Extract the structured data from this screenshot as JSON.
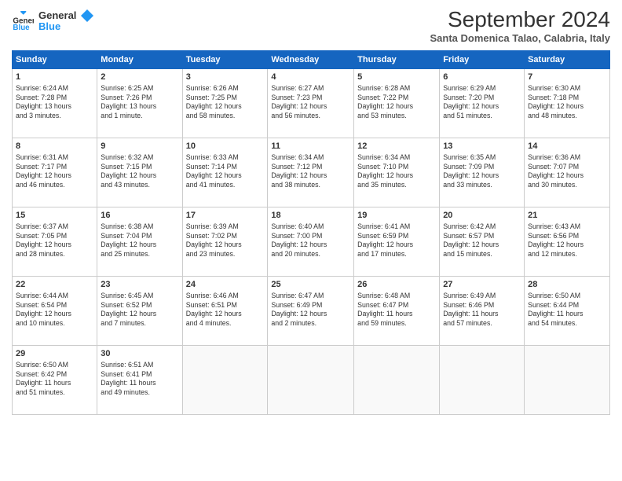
{
  "logo": {
    "line1": "General",
    "line2": "Blue"
  },
  "title": "September 2024",
  "subtitle": "Santa Domenica Talao, Calabria, Italy",
  "headers": [
    "Sunday",
    "Monday",
    "Tuesday",
    "Wednesday",
    "Thursday",
    "Friday",
    "Saturday"
  ],
  "weeks": [
    [
      {
        "day": "1",
        "info": "Sunrise: 6:24 AM\nSunset: 7:28 PM\nDaylight: 13 hours\nand 3 minutes."
      },
      {
        "day": "2",
        "info": "Sunrise: 6:25 AM\nSunset: 7:26 PM\nDaylight: 13 hours\nand 1 minute."
      },
      {
        "day": "3",
        "info": "Sunrise: 6:26 AM\nSunset: 7:25 PM\nDaylight: 12 hours\nand 58 minutes."
      },
      {
        "day": "4",
        "info": "Sunrise: 6:27 AM\nSunset: 7:23 PM\nDaylight: 12 hours\nand 56 minutes."
      },
      {
        "day": "5",
        "info": "Sunrise: 6:28 AM\nSunset: 7:22 PM\nDaylight: 12 hours\nand 53 minutes."
      },
      {
        "day": "6",
        "info": "Sunrise: 6:29 AM\nSunset: 7:20 PM\nDaylight: 12 hours\nand 51 minutes."
      },
      {
        "day": "7",
        "info": "Sunrise: 6:30 AM\nSunset: 7:18 PM\nDaylight: 12 hours\nand 48 minutes."
      }
    ],
    [
      {
        "day": "8",
        "info": "Sunrise: 6:31 AM\nSunset: 7:17 PM\nDaylight: 12 hours\nand 46 minutes."
      },
      {
        "day": "9",
        "info": "Sunrise: 6:32 AM\nSunset: 7:15 PM\nDaylight: 12 hours\nand 43 minutes."
      },
      {
        "day": "10",
        "info": "Sunrise: 6:33 AM\nSunset: 7:14 PM\nDaylight: 12 hours\nand 41 minutes."
      },
      {
        "day": "11",
        "info": "Sunrise: 6:34 AM\nSunset: 7:12 PM\nDaylight: 12 hours\nand 38 minutes."
      },
      {
        "day": "12",
        "info": "Sunrise: 6:34 AM\nSunset: 7:10 PM\nDaylight: 12 hours\nand 35 minutes."
      },
      {
        "day": "13",
        "info": "Sunrise: 6:35 AM\nSunset: 7:09 PM\nDaylight: 12 hours\nand 33 minutes."
      },
      {
        "day": "14",
        "info": "Sunrise: 6:36 AM\nSunset: 7:07 PM\nDaylight: 12 hours\nand 30 minutes."
      }
    ],
    [
      {
        "day": "15",
        "info": "Sunrise: 6:37 AM\nSunset: 7:05 PM\nDaylight: 12 hours\nand 28 minutes."
      },
      {
        "day": "16",
        "info": "Sunrise: 6:38 AM\nSunset: 7:04 PM\nDaylight: 12 hours\nand 25 minutes."
      },
      {
        "day": "17",
        "info": "Sunrise: 6:39 AM\nSunset: 7:02 PM\nDaylight: 12 hours\nand 23 minutes."
      },
      {
        "day": "18",
        "info": "Sunrise: 6:40 AM\nSunset: 7:00 PM\nDaylight: 12 hours\nand 20 minutes."
      },
      {
        "day": "19",
        "info": "Sunrise: 6:41 AM\nSunset: 6:59 PM\nDaylight: 12 hours\nand 17 minutes."
      },
      {
        "day": "20",
        "info": "Sunrise: 6:42 AM\nSunset: 6:57 PM\nDaylight: 12 hours\nand 15 minutes."
      },
      {
        "day": "21",
        "info": "Sunrise: 6:43 AM\nSunset: 6:56 PM\nDaylight: 12 hours\nand 12 minutes."
      }
    ],
    [
      {
        "day": "22",
        "info": "Sunrise: 6:44 AM\nSunset: 6:54 PM\nDaylight: 12 hours\nand 10 minutes."
      },
      {
        "day": "23",
        "info": "Sunrise: 6:45 AM\nSunset: 6:52 PM\nDaylight: 12 hours\nand 7 minutes."
      },
      {
        "day": "24",
        "info": "Sunrise: 6:46 AM\nSunset: 6:51 PM\nDaylight: 12 hours\nand 4 minutes."
      },
      {
        "day": "25",
        "info": "Sunrise: 6:47 AM\nSunset: 6:49 PM\nDaylight: 12 hours\nand 2 minutes."
      },
      {
        "day": "26",
        "info": "Sunrise: 6:48 AM\nSunset: 6:47 PM\nDaylight: 11 hours\nand 59 minutes."
      },
      {
        "day": "27",
        "info": "Sunrise: 6:49 AM\nSunset: 6:46 PM\nDaylight: 11 hours\nand 57 minutes."
      },
      {
        "day": "28",
        "info": "Sunrise: 6:50 AM\nSunset: 6:44 PM\nDaylight: 11 hours\nand 54 minutes."
      }
    ],
    [
      {
        "day": "29",
        "info": "Sunrise: 6:50 AM\nSunset: 6:42 PM\nDaylight: 11 hours\nand 51 minutes."
      },
      {
        "day": "30",
        "info": "Sunrise: 6:51 AM\nSunset: 6:41 PM\nDaylight: 11 hours\nand 49 minutes."
      },
      {
        "day": "",
        "info": ""
      },
      {
        "day": "",
        "info": ""
      },
      {
        "day": "",
        "info": ""
      },
      {
        "day": "",
        "info": ""
      },
      {
        "day": "",
        "info": ""
      }
    ]
  ]
}
